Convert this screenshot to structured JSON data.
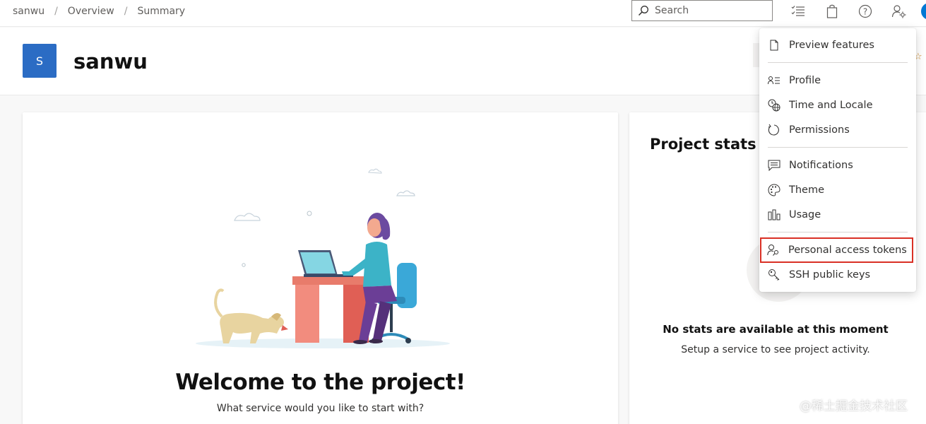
{
  "breadcrumb": {
    "items": [
      {
        "label": "sanwu"
      },
      {
        "label": "Overview"
      },
      {
        "label": "Summary"
      }
    ],
    "separator": "/"
  },
  "search": {
    "placeholder": "Search",
    "value": "",
    "icon": "search-icon"
  },
  "toolbar": {
    "icons": [
      "task-list-icon",
      "shopping-bag-icon",
      "help-icon",
      "user-settings-icon"
    ]
  },
  "project": {
    "avatar_letter": "S",
    "name": "sanwu",
    "avatar_color": "#2b6cc4"
  },
  "welcome": {
    "title": "Welcome to the project!",
    "subtitle": "What service would you like to start with?"
  },
  "stats": {
    "title": "Project stats",
    "empty_title": "No stats are available at this moment",
    "empty_subtitle": "Setup a service to see project activity."
  },
  "user_menu": {
    "items": [
      {
        "label": "Preview features",
        "icon": "document-icon"
      },
      {
        "label": "Profile",
        "icon": "contact-card-icon"
      },
      {
        "label": "Time and Locale",
        "icon": "globe-clock-icon"
      },
      {
        "label": "Permissions",
        "icon": "refresh-icon"
      },
      {
        "label": "Notifications",
        "icon": "message-icon"
      },
      {
        "label": "Theme",
        "icon": "palette-icon"
      },
      {
        "label": "Usage",
        "icon": "bar-chart-icon"
      },
      {
        "label": "Personal access tokens",
        "icon": "person-key-icon",
        "highlighted": true
      },
      {
        "label": "SSH public keys",
        "icon": "key-icon"
      }
    ],
    "highlight_color": "#d93025"
  },
  "watermark": "@稀土掘金技术社区"
}
